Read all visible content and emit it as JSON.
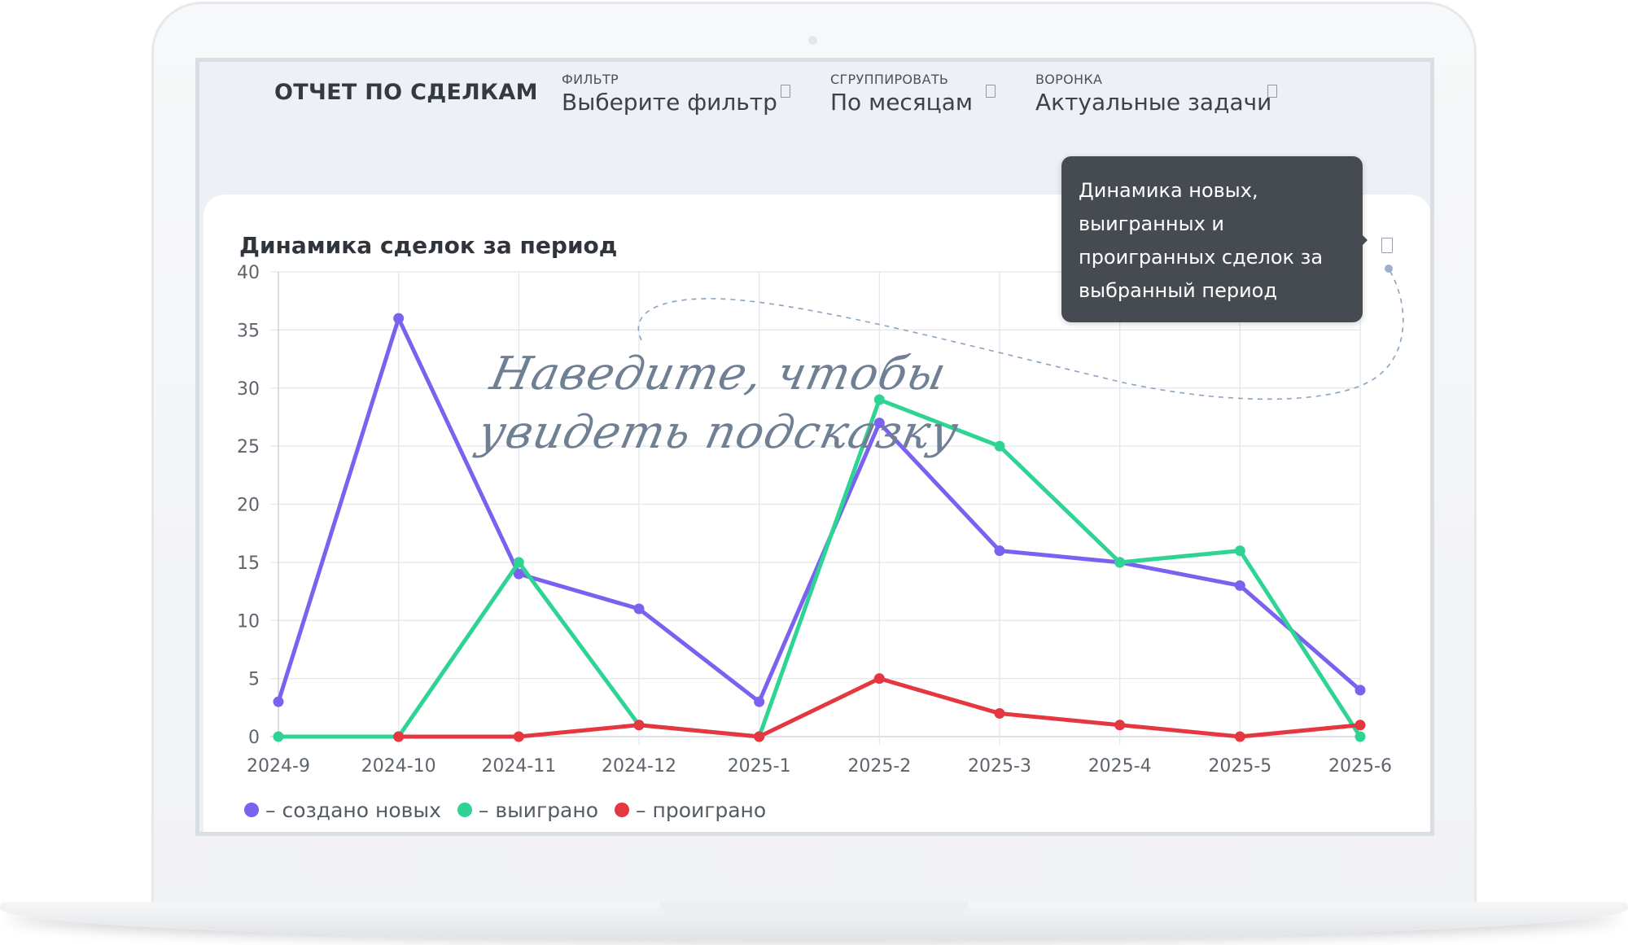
{
  "app": {
    "report_title": "ОТЧЕТ ПО СДЕЛКАМ",
    "controls": [
      {
        "label": "ФИЛЬТР",
        "value": "Выберите фильтр"
      },
      {
        "label": "СГРУППИРОВАТЬ",
        "value": "По месяцам"
      },
      {
        "label": "ВОРОНКА",
        "value": "Актуальные задачи"
      }
    ]
  },
  "card": {
    "title": "Динамика сделок за период",
    "tooltip_lines": [
      "Динамика новых,",
      "выигранных и",
      "проигранных сделок за",
      "выбранный период"
    ],
    "hint_lines": [
      "Наведите, чтобы",
      "увидеть подсказку"
    ]
  },
  "chart_data": {
    "type": "line",
    "categories": [
      "2024-9",
      "2024-10",
      "2024-11",
      "2024-12",
      "2025-1",
      "2025-2",
      "2025-3",
      "2025-4",
      "2025-5",
      "2025-6"
    ],
    "y_ticks": [
      0,
      5,
      10,
      15,
      20,
      25,
      30,
      35,
      40
    ],
    "ylim": [
      0,
      40
    ],
    "grid": true,
    "legend_position": "bottom-left",
    "series": [
      {
        "name": "– создано новых",
        "color": "#7b61ef",
        "values": [
          3,
          36,
          14,
          11,
          3,
          27,
          16,
          15,
          13,
          4
        ]
      },
      {
        "name": "– выиграно",
        "color": "#2fd494",
        "values": [
          0,
          0,
          15,
          1,
          0,
          29,
          25,
          15,
          16,
          0
        ]
      },
      {
        "name": "– проиграно",
        "color": "#e5373f",
        "values": [
          null,
          0,
          0,
          1,
          0,
          5,
          2,
          1,
          0,
          1
        ]
      }
    ]
  }
}
